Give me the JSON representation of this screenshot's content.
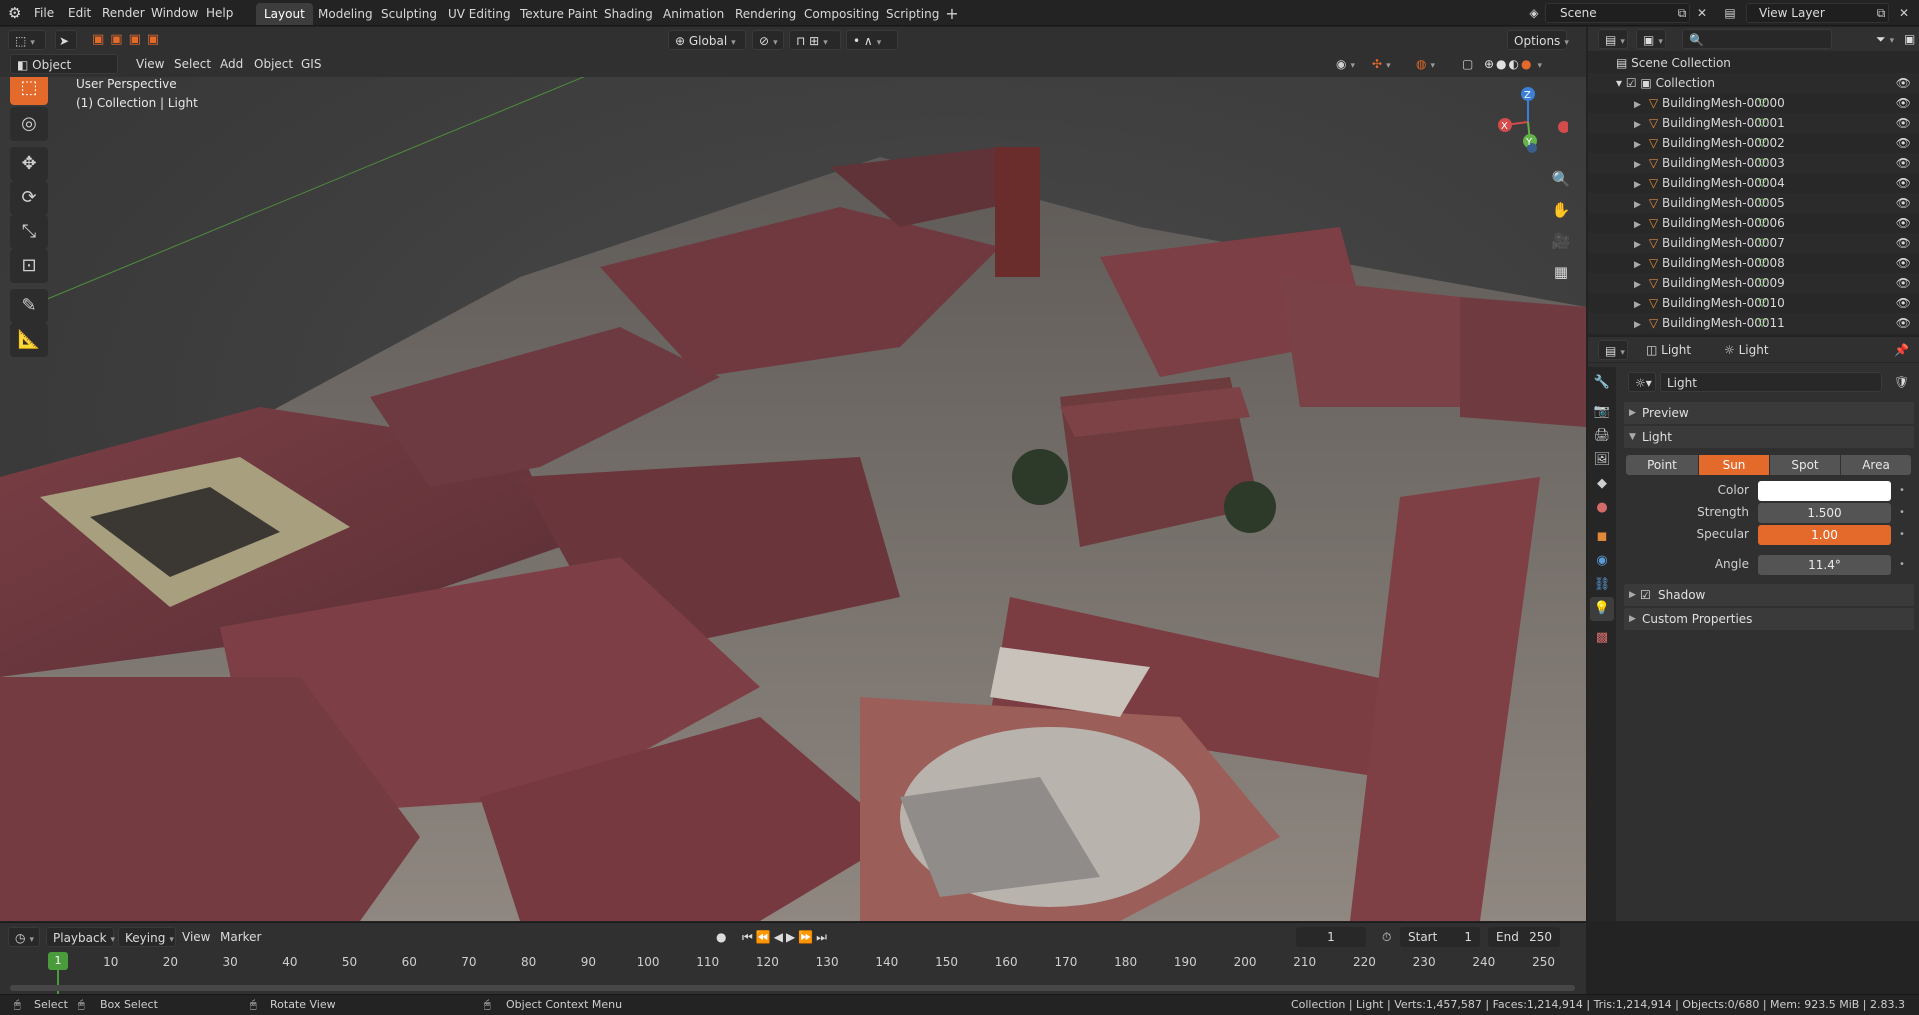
{
  "topbar": {
    "menus": [
      "File",
      "Edit",
      "Render",
      "Window",
      "Help"
    ],
    "workspaces": [
      "Layout",
      "Modeling",
      "Sculpting",
      "UV Editing",
      "Texture Paint",
      "Shading",
      "Animation",
      "Rendering",
      "Compositing",
      "Scripting"
    ],
    "active_workspace": "Layout",
    "scene": "Scene",
    "view_layer": "View Layer"
  },
  "viewport_header": {
    "mode": "Object Mode",
    "menus": [
      "View",
      "Select",
      "Add",
      "Object",
      "GIS"
    ],
    "transform_orientation": "Global",
    "options": "Options"
  },
  "viewport": {
    "perspective": "User Perspective",
    "context": "(1) Collection | Light",
    "gizmo_axes": [
      "X",
      "Y",
      "Z"
    ]
  },
  "outliner": {
    "root": "Scene Collection",
    "collection": "Collection",
    "items": [
      "BuildingMesh-00000",
      "BuildingMesh-00001",
      "BuildingMesh-00002",
      "BuildingMesh-00003",
      "BuildingMesh-00004",
      "BuildingMesh-00005",
      "BuildingMesh-00006",
      "BuildingMesh-00007",
      "BuildingMesh-00008",
      "BuildingMesh-00009",
      "BuildingMesh-00010",
      "BuildingMesh-00011"
    ]
  },
  "properties": {
    "breadcrumb_object": "Light",
    "breadcrumb_data": "Light",
    "datablock_name": "Light",
    "panels": {
      "preview": "Preview",
      "light": "Light",
      "shadow": "Shadow",
      "custom": "Custom Properties"
    },
    "light_types": [
      "Point",
      "Sun",
      "Spot",
      "Area"
    ],
    "active_type": "Sun",
    "color_label": "Color",
    "color_value": "#ffffff",
    "strength_label": "Strength",
    "strength": "1.500",
    "specular_label": "Specular",
    "specular": "1.00",
    "angle_label": "Angle",
    "angle": "11.4°"
  },
  "timeline": {
    "menus": [
      "Playback",
      "Keying",
      "View",
      "Marker"
    ],
    "current_frame": "1",
    "start_label": "Start",
    "start": "1",
    "end_label": "End",
    "end": "250",
    "ticks": [
      "10",
      "20",
      "30",
      "40",
      "50",
      "60",
      "70",
      "80",
      "90",
      "100",
      "110",
      "120",
      "130",
      "140",
      "150",
      "160",
      "170",
      "180",
      "190",
      "200",
      "210",
      "220",
      "230",
      "240",
      "250"
    ],
    "playhead": "1"
  },
  "statusbar": {
    "select": "Select",
    "box_select": "Box Select",
    "rotate": "Rotate View",
    "context_menu": "Object Context Menu",
    "stats": "Collection | Light | Verts:1,457,587 | Faces:1,214,914 | Tris:1,214,914 | Objects:0/680 | Mem: 923.5 MiB | 2.83.3"
  }
}
